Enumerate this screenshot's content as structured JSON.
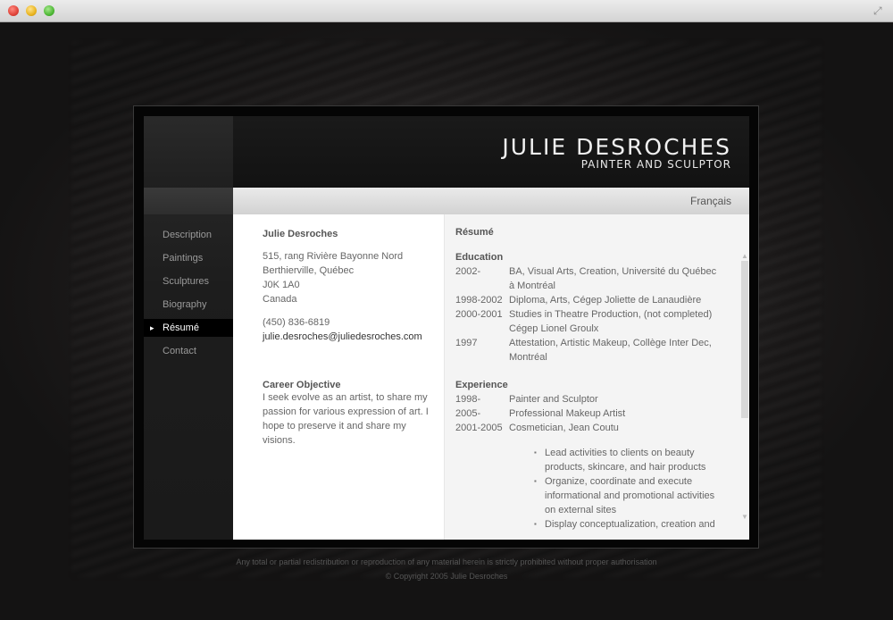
{
  "window": {
    "controls": [
      "close",
      "minimize",
      "zoom"
    ]
  },
  "header": {
    "name": "JULIE DESROCHES",
    "tagline": "PAINTER AND SCULPTOR"
  },
  "language": {
    "label": "Français"
  },
  "nav": {
    "items": [
      {
        "label": "Description",
        "active": false
      },
      {
        "label": "Paintings",
        "active": false
      },
      {
        "label": "Sculptures",
        "active": false
      },
      {
        "label": "Biography",
        "active": false
      },
      {
        "label": "Résumé",
        "active": true
      },
      {
        "label": "Contact",
        "active": false
      }
    ]
  },
  "contact": {
    "name": "Julie Desroches",
    "address": [
      "515, rang Rivière Bayonne Nord",
      "Berthierville, Québec",
      "J0K 1A0",
      "Canada"
    ],
    "phone": "(450) 836-6819",
    "email": "julie.desroches@juliedesroches.com"
  },
  "career": {
    "heading": "Career Objective",
    "text": "I seek evolve as an artist, to share my passion for various expression of art. I hope to preserve it and share my visions."
  },
  "resume": {
    "title": "Résumé",
    "education_heading": "Education",
    "education": [
      {
        "year": "2002-",
        "text": "BA, Visual Arts, Creation, Université du Québec à Montréal"
      },
      {
        "year": "1998-2002",
        "text": "Diploma, Arts, Cégep Joliette de Lanaudière"
      },
      {
        "year": "2000-2001",
        "text": "Studies in Theatre Production, (not completed) Cégep Lionel Groulx"
      },
      {
        "year": "1997",
        "text": "Attestation, Artistic Makeup, Collège Inter Dec, Montréal"
      }
    ],
    "experience_heading": "Experience",
    "experience": [
      {
        "year": "1998-",
        "text": "Painter and Sculptor"
      },
      {
        "year": "2005-",
        "text": "Professional Makeup Artist"
      },
      {
        "year": "2001-2005",
        "text": "Cosmetician, Jean Coutu"
      }
    ],
    "duties": [
      "Lead activities to clients on beauty products, skincare, and hair products",
      "Organize, coordinate and execute informational and promotional activities on external sites",
      "Display conceptualization, creation and"
    ]
  },
  "footer": {
    "notice": "Any total or partial redistribution or reproduction of any material herein is strictly prohibited without proper authorisation",
    "copyright": "© Copyright 2005 Julie Desroches"
  },
  "colors": {
    "background": "#1a1818",
    "frame": "#050505",
    "content": "#ffffff",
    "panel": "#f4f4f4",
    "nav_active": "#000000"
  },
  "icons": {
    "expand": "expand-icon",
    "nav_marker": "arrow-right-icon",
    "scroll_up": "scroll-up-icon",
    "scroll_down": "scroll-down-icon"
  }
}
